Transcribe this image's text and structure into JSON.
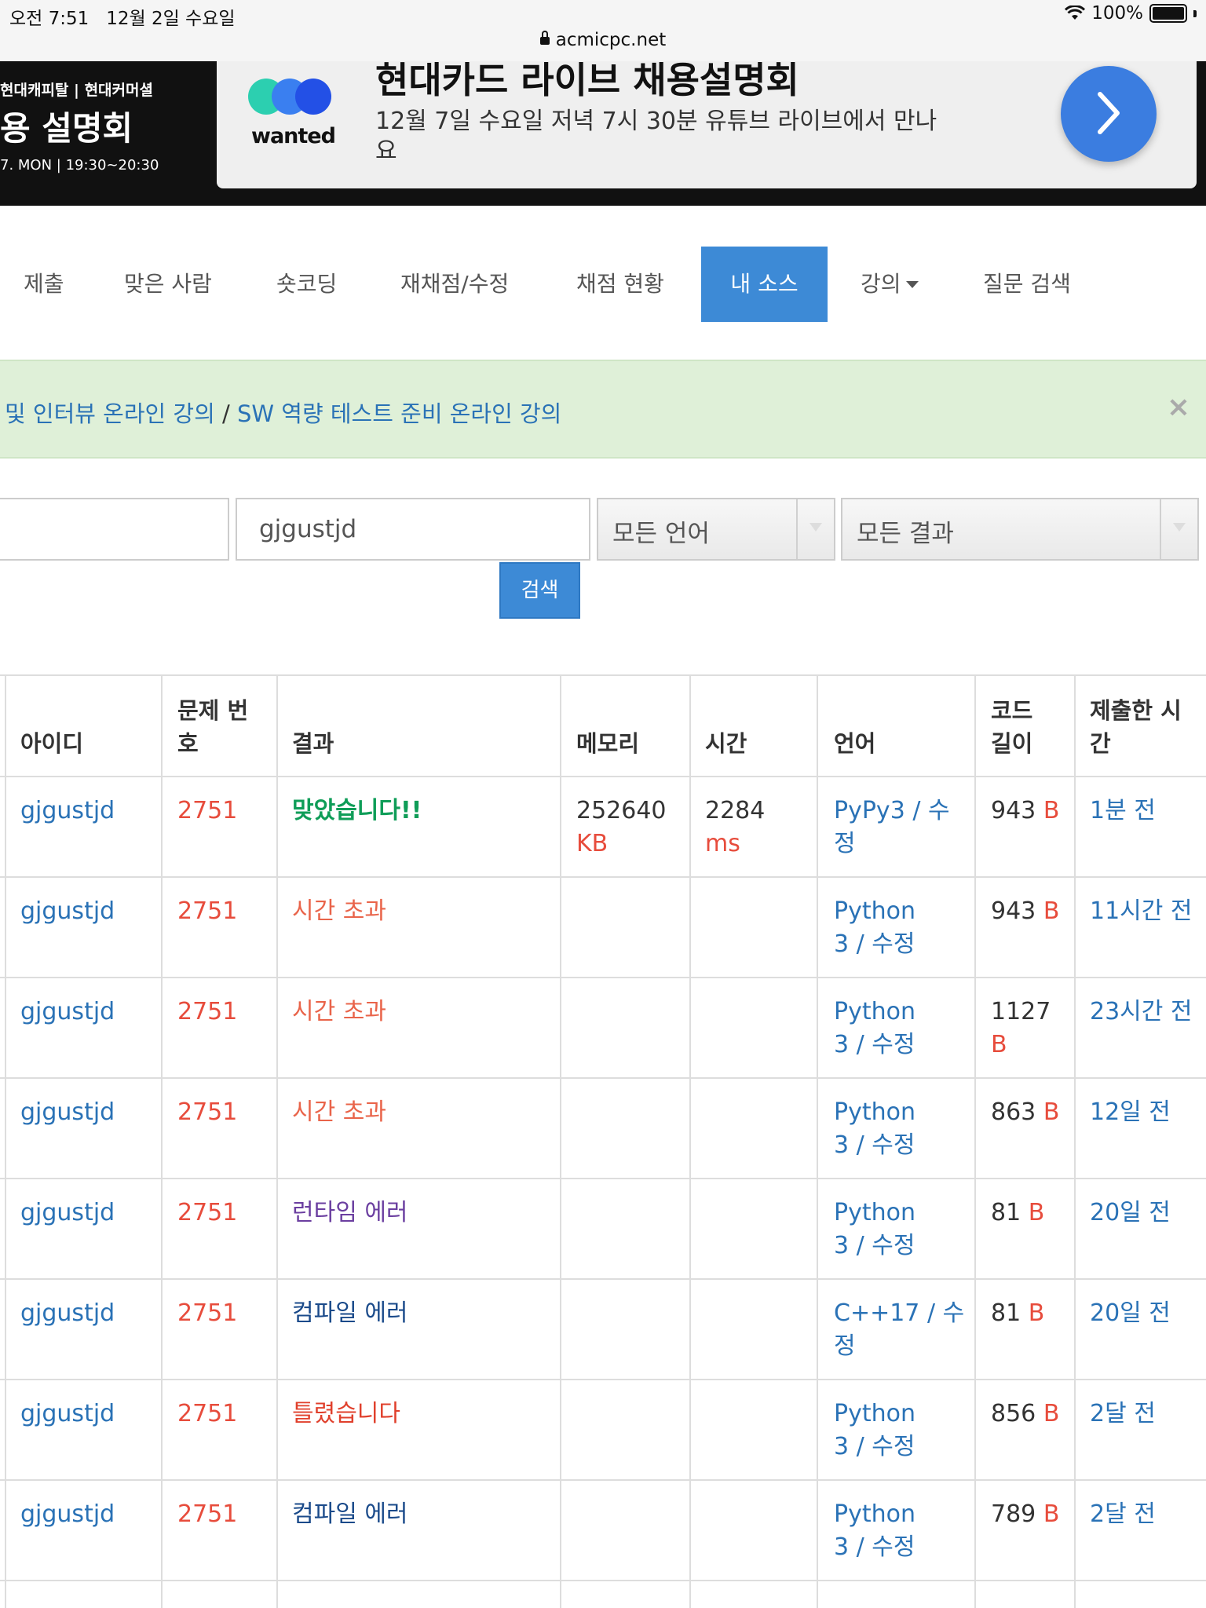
{
  "statusbar": {
    "time": "오전 7:51",
    "date": "12월 2일 수요일",
    "battery": "100%"
  },
  "browser": {
    "url": "acmicpc.net"
  },
  "ad": {
    "left_line1": "현대캐피탈 | 현대커머셜",
    "left_line2": "용 설명회",
    "left_line3": "7. MON | 19:30~20:30",
    "brand": "wanted",
    "title": "현대카드 라이브 채용설명회",
    "subtitle": "12월 7일 수요일 저녁 7시 30분 유튜브 라이브에서 만나요"
  },
  "nav": {
    "items": [
      {
        "label": "제출"
      },
      {
        "label": "맞은 사람"
      },
      {
        "label": "숏코딩"
      },
      {
        "label": "재채점/수정"
      },
      {
        "label": "채점 현황"
      },
      {
        "label": "내 소스"
      },
      {
        "label": "강의"
      },
      {
        "label": "질문 검색"
      }
    ],
    "active": "내 소스"
  },
  "alert": {
    "text_a": "및 인터뷰 온라인 강의",
    "sep": " / ",
    "text_b": "SW 역량 테스트 준비 온라인 강의",
    "close": "×"
  },
  "search": {
    "problem_value": "",
    "user_value": "gjgustjd",
    "language_select": "모든 언어",
    "result_select": "모든 결과",
    "button": "검색"
  },
  "table": {
    "headers": {
      "id": "아이디",
      "problem_l1": "문제 번",
      "problem_l2": "호",
      "result": "결과",
      "memory": "메모리",
      "time": "시간",
      "lang": "언어",
      "code_l1": "코드",
      "code_l2": "길이",
      "submit_l1": "제출한 시",
      "submit_l2": "간"
    },
    "rows": [
      {
        "id": "gjgustjd",
        "problem": "2751",
        "result": "맞았습니다!!",
        "memory": "252640",
        "memory_unit": "KB",
        "time": "2284",
        "time_unit": "ms",
        "lang_l1": "PyPy3",
        "lang_l2": "",
        "lang_edit_l1": " / 수",
        "lang_edit_l2": "정",
        "code": "943",
        "code_unit": "B",
        "submitted": "1분 전"
      },
      {
        "id": "gjgustjd",
        "problem": "2751",
        "result": "시간 초과",
        "memory": "",
        "memory_unit": "",
        "time": "",
        "time_unit": "",
        "lang_l1": "Python",
        "lang_l2": "3",
        "lang_edit_l1": "",
        "lang_edit_l2": " / 수정",
        "code": "943",
        "code_unit": "B",
        "submitted": "11시간 전"
      },
      {
        "id": "gjgustjd",
        "problem": "2751",
        "result": "시간 초과",
        "memory": "",
        "memory_unit": "",
        "time": "",
        "time_unit": "",
        "lang_l1": "Python",
        "lang_l2": "3",
        "lang_edit_l1": "",
        "lang_edit_l2": " / 수정",
        "code": "1127",
        "code_unit": "B",
        "submitted": "23시간 전"
      },
      {
        "id": "gjgustjd",
        "problem": "2751",
        "result": "시간 초과",
        "memory": "",
        "memory_unit": "",
        "time": "",
        "time_unit": "",
        "lang_l1": "Python",
        "lang_l2": "3",
        "lang_edit_l1": "",
        "lang_edit_l2": " / 수정",
        "code": "863",
        "code_unit": "B",
        "submitted": "12일 전"
      },
      {
        "id": "gjgustjd",
        "problem": "2751",
        "result": "런타임 에러",
        "memory": "",
        "memory_unit": "",
        "time": "",
        "time_unit": "",
        "lang_l1": "Python",
        "lang_l2": "3",
        "lang_edit_l1": "",
        "lang_edit_l2": " / 수정",
        "code": "81",
        "code_unit": "B",
        "submitted": "20일 전"
      },
      {
        "id": "gjgustjd",
        "problem": "2751",
        "result": "컴파일 에러",
        "memory": "",
        "memory_unit": "",
        "time": "",
        "time_unit": "",
        "lang_l1": "C++17",
        "lang_l2": "",
        "lang_edit_l1": " / 수",
        "lang_edit_l2": "정",
        "code": "81",
        "code_unit": "B",
        "submitted": "20일 전"
      },
      {
        "id": "gjgustjd",
        "problem": "2751",
        "result": "틀렸습니다",
        "memory": "",
        "memory_unit": "",
        "time": "",
        "time_unit": "",
        "lang_l1": "Python",
        "lang_l2": "3",
        "lang_edit_l1": "",
        "lang_edit_l2": " / 수정",
        "code": "856",
        "code_unit": "B",
        "submitted": "2달 전"
      },
      {
        "id": "gjgustjd",
        "problem": "2751",
        "result": "컴파일 에러",
        "memory": "",
        "memory_unit": "",
        "time": "",
        "time_unit": "",
        "lang_l1": "Python",
        "lang_l2": "3",
        "lang_edit_l1": "",
        "lang_edit_l2": " / 수정",
        "code": "789",
        "code_unit": "B",
        "submitted": "2달 전"
      }
    ]
  }
}
